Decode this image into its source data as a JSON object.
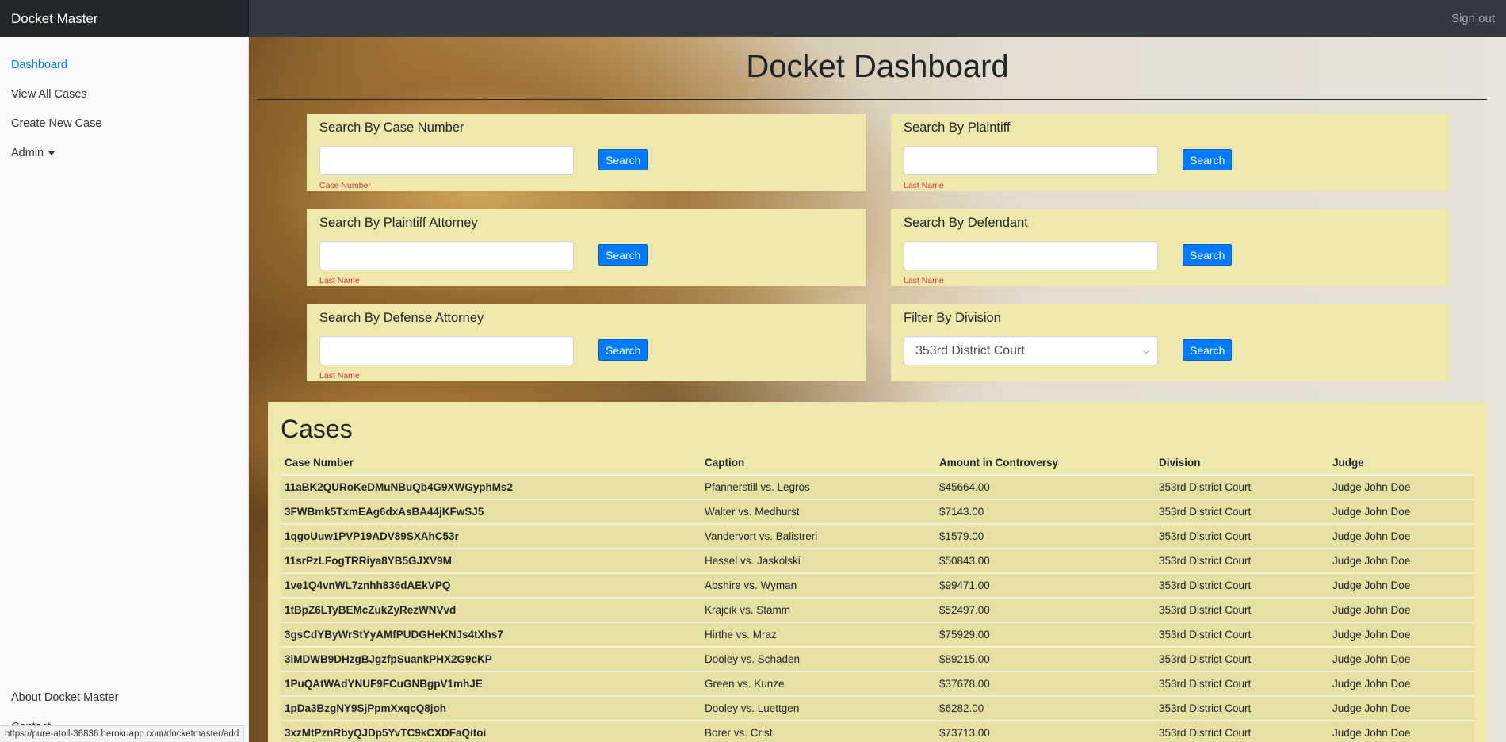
{
  "app": {
    "brand": "Docket Master",
    "sign_out": "Sign out"
  },
  "sidebar": {
    "items": [
      {
        "label": "Dashboard",
        "active": true
      },
      {
        "label": "View All Cases"
      },
      {
        "label": "Create New Case"
      },
      {
        "label": "Admin"
      }
    ],
    "about": "About Docket Master",
    "contact": "Contact"
  },
  "status_url": "https://pure-atoll-36836.herokuapp.com/docketmaster/add",
  "page": {
    "title": "Docket Dashboard"
  },
  "search": {
    "case_number": {
      "title": "Search By Case Number",
      "hint": "Case Number",
      "value": "",
      "button": "Search"
    },
    "plaintiff": {
      "title": "Search By Plaintiff",
      "hint": "Last Name",
      "value": "",
      "button": "Search"
    },
    "plaintiff_attorney": {
      "title": "Search By Plaintiff Attorney",
      "hint": "Last Name",
      "value": "",
      "button": "Search"
    },
    "defendant": {
      "title": "Search By Defendant",
      "hint": "Last Name",
      "value": "",
      "button": "Search"
    },
    "defense_attorney": {
      "title": "Search By Defense Attorney",
      "hint": "Last Name",
      "value": "",
      "button": "Search"
    },
    "division": {
      "title": "Filter By Division",
      "selected": "353rd District Court",
      "button": "Search"
    }
  },
  "cases": {
    "heading": "Cases",
    "columns": [
      "Case Number",
      "Caption",
      "Amount in Controversy",
      "Division",
      "Judge"
    ],
    "rows": [
      [
        "11aBK2QURoKeDMuNBuQb4G9XWGyphMs2",
        "Pfannerstill vs. Legros",
        "$45664.00",
        "353rd District Court",
        "Judge John Doe"
      ],
      [
        "3FWBmk5TxmEAg6dxAsBA44jKFwSJ5",
        "Walter vs. Medhurst",
        "$7143.00",
        "353rd District Court",
        "Judge John Doe"
      ],
      [
        "1qgoUuw1PVP19ADV89SXAhC53r",
        "Vandervort vs. Balistreri",
        "$1579.00",
        "353rd District Court",
        "Judge John Doe"
      ],
      [
        "11srPzLFogTRRiya8YB5GJXV9M",
        "Hessel vs. Jaskolski",
        "$50843.00",
        "353rd District Court",
        "Judge John Doe"
      ],
      [
        "1ve1Q4vnWL7znhh836dAEkVPQ",
        "Abshire vs. Wyman",
        "$99471.00",
        "353rd District Court",
        "Judge John Doe"
      ],
      [
        "1tBpZ6LTyBEMcZukZyRezWNVvd",
        "Krajcik vs. Stamm",
        "$52497.00",
        "353rd District Court",
        "Judge John Doe"
      ],
      [
        "3gsCdYByWrStYyAMfPUDGHeKNJs4tXhs7",
        "Hirthe vs. Mraz",
        "$75929.00",
        "353rd District Court",
        "Judge John Doe"
      ],
      [
        "3iMDWB9DHzgBJgzfpSuankPHX2G9cKP",
        "Dooley vs. Schaden",
        "$89215.00",
        "353rd District Court",
        "Judge John Doe"
      ],
      [
        "1PuQAtWAdYNUF9FCuGNBgpV1mhJE",
        "Green vs. Kunze",
        "$37678.00",
        "353rd District Court",
        "Judge John Doe"
      ],
      [
        "1pDa3BzgNY9SjPpmXxqcQ8joh",
        "Dooley vs. Luettgen",
        "$6282.00",
        "353rd District Court",
        "Judge John Doe"
      ],
      [
        "3xzMtPznRbyQJDp5YvTC9kCXDFaQitoi",
        "Borer vs. Crist",
        "$73713.00",
        "353rd District Court",
        "Judge John Doe"
      ]
    ]
  }
}
